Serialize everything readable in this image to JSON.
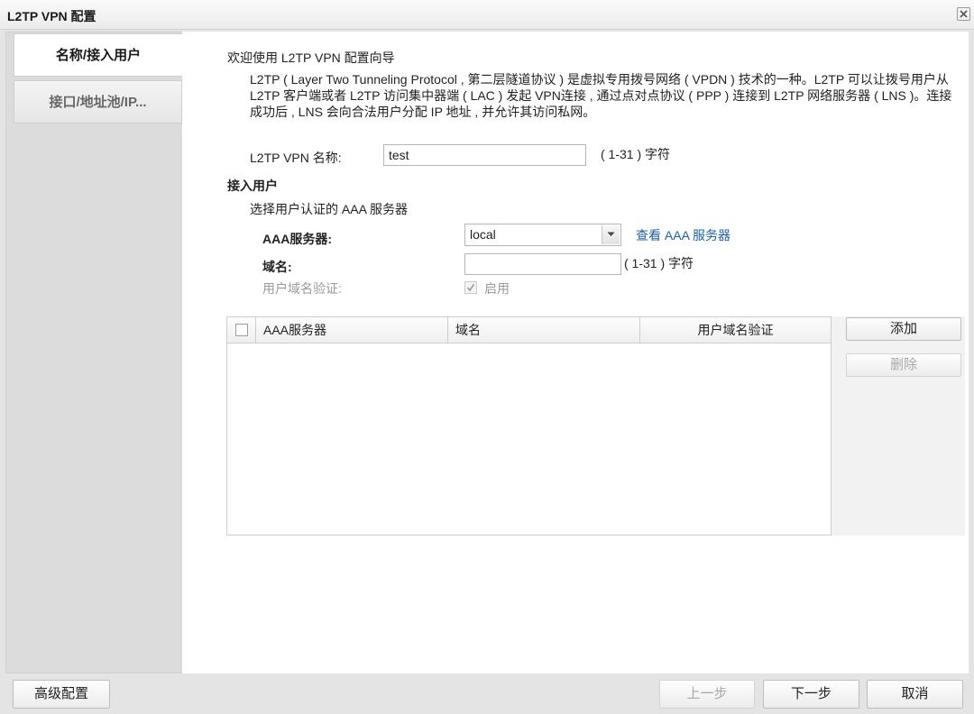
{
  "window": {
    "title": "L2TP VPN 配置"
  },
  "nav": {
    "tabs": [
      {
        "label": "名称/接入用户"
      },
      {
        "label": "接口/地址池/IP..."
      }
    ]
  },
  "intro": {
    "title": "欢迎使用 L2TP VPN 配置向导",
    "description": "L2TP ( Layer Two Tunneling Protocol , 第二层隧道协议 ) 是虚拟专用拨号网络 ( VPDN ) 技术的一种。L2TP 可以让拨号用户从 L2TP 客户端或者 L2TP 访问集中器端 ( LAC ) 发起 VPN连接 , 通过点对点协议 ( PPP ) 连接到 L2TP 网络服务器 ( LNS )。连接成功后 , LNS 会向合法用户分配 IP 地址 , 并允许其访问私网。"
  },
  "form": {
    "name_label": "L2TP VPN 名称:",
    "name_value": "test",
    "name_hint": "( 1-31 ) 字符",
    "section_title": "接入用户",
    "select_hint": "选择用户认证的 AAA 服务器",
    "aaa_label": "AAA服务器:",
    "aaa_value": "local",
    "aaa_link": "查看 AAA 服务器",
    "domain_label": "域名:",
    "domain_value": "",
    "domain_hint": "( 1-31 ) 字符",
    "verify_label": "用户域名验证:",
    "verify_checked": true,
    "verify_option": "启用"
  },
  "table": {
    "columns": [
      "AAA服务器",
      "域名",
      "用户域名验证"
    ],
    "rows": []
  },
  "side_buttons": {
    "add": "添加",
    "delete": "删除"
  },
  "footer": {
    "advanced": "高级配置",
    "prev": "上一步",
    "next": "下一步",
    "cancel": "取消"
  }
}
